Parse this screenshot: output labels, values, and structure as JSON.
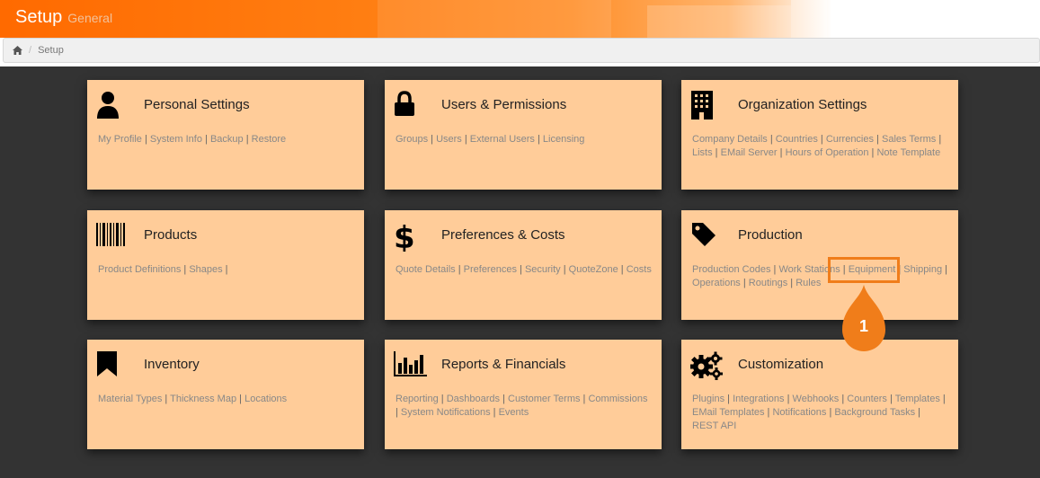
{
  "header": {
    "title": "Setup",
    "subtitle": "General"
  },
  "breadcrumb": {
    "home_icon": "home-icon",
    "separator": "/",
    "current": "Setup"
  },
  "cards": [
    {
      "title": "Personal Settings",
      "icon": "user-icon",
      "links": [
        "My Profile",
        "System Info",
        "Backup",
        "Restore"
      ],
      "trailing_sep": false
    },
    {
      "title": "Users & Permissions",
      "icon": "lock-icon",
      "links": [
        "Groups",
        "Users",
        "External Users",
        "Licensing"
      ],
      "trailing_sep": false
    },
    {
      "title": "Organization Settings",
      "icon": "building-icon",
      "links": [
        "Company Details",
        "Countries",
        "Currencies",
        "Sales Terms",
        "Lists",
        "EMail Server",
        "Hours of Operation",
        "Note Template"
      ],
      "trailing_sep": false
    },
    {
      "title": "Products",
      "icon": "barcode-icon",
      "links": [
        "Product Definitions",
        "Shapes"
      ],
      "trailing_sep": true
    },
    {
      "title": "Preferences & Costs",
      "icon": "dollar-icon",
      "links": [
        "Quote Details",
        "Preferences",
        "Security",
        "QuoteZone",
        "Costs"
      ],
      "trailing_sep": false
    },
    {
      "title": "Production",
      "icon": "tag-icon",
      "links": [
        "Production Codes",
        "Work Stations",
        "Equipment",
        "Shipping",
        "Operations",
        "Routings",
        "Rules"
      ],
      "trailing_sep": false
    },
    {
      "title": "Inventory",
      "icon": "bookmark-icon",
      "links": [
        "Material Types",
        "Thickness Map",
        "Locations"
      ],
      "trailing_sep": false
    },
    {
      "title": "Reports & Financials",
      "icon": "bar-chart-icon",
      "links": [
        "Reporting",
        "Dashboards",
        "Customer Terms",
        "Commissions",
        "System Notifications",
        "Events"
      ],
      "trailing_sep": false
    },
    {
      "title": "Customization",
      "icon": "gears-icon",
      "links": [
        "Plugins",
        "Integrations",
        "Webhooks",
        "Counters",
        "Templates",
        "EMail Templates",
        "Notifications",
        "Background Tasks",
        "REST API"
      ],
      "trailing_sep": false
    }
  ],
  "annotation": {
    "number": "1",
    "target": "Equipment",
    "color": "#f07d1a"
  },
  "colors": {
    "background": "#333333",
    "card": "#ffcc99",
    "accent": "#ff6a00"
  }
}
